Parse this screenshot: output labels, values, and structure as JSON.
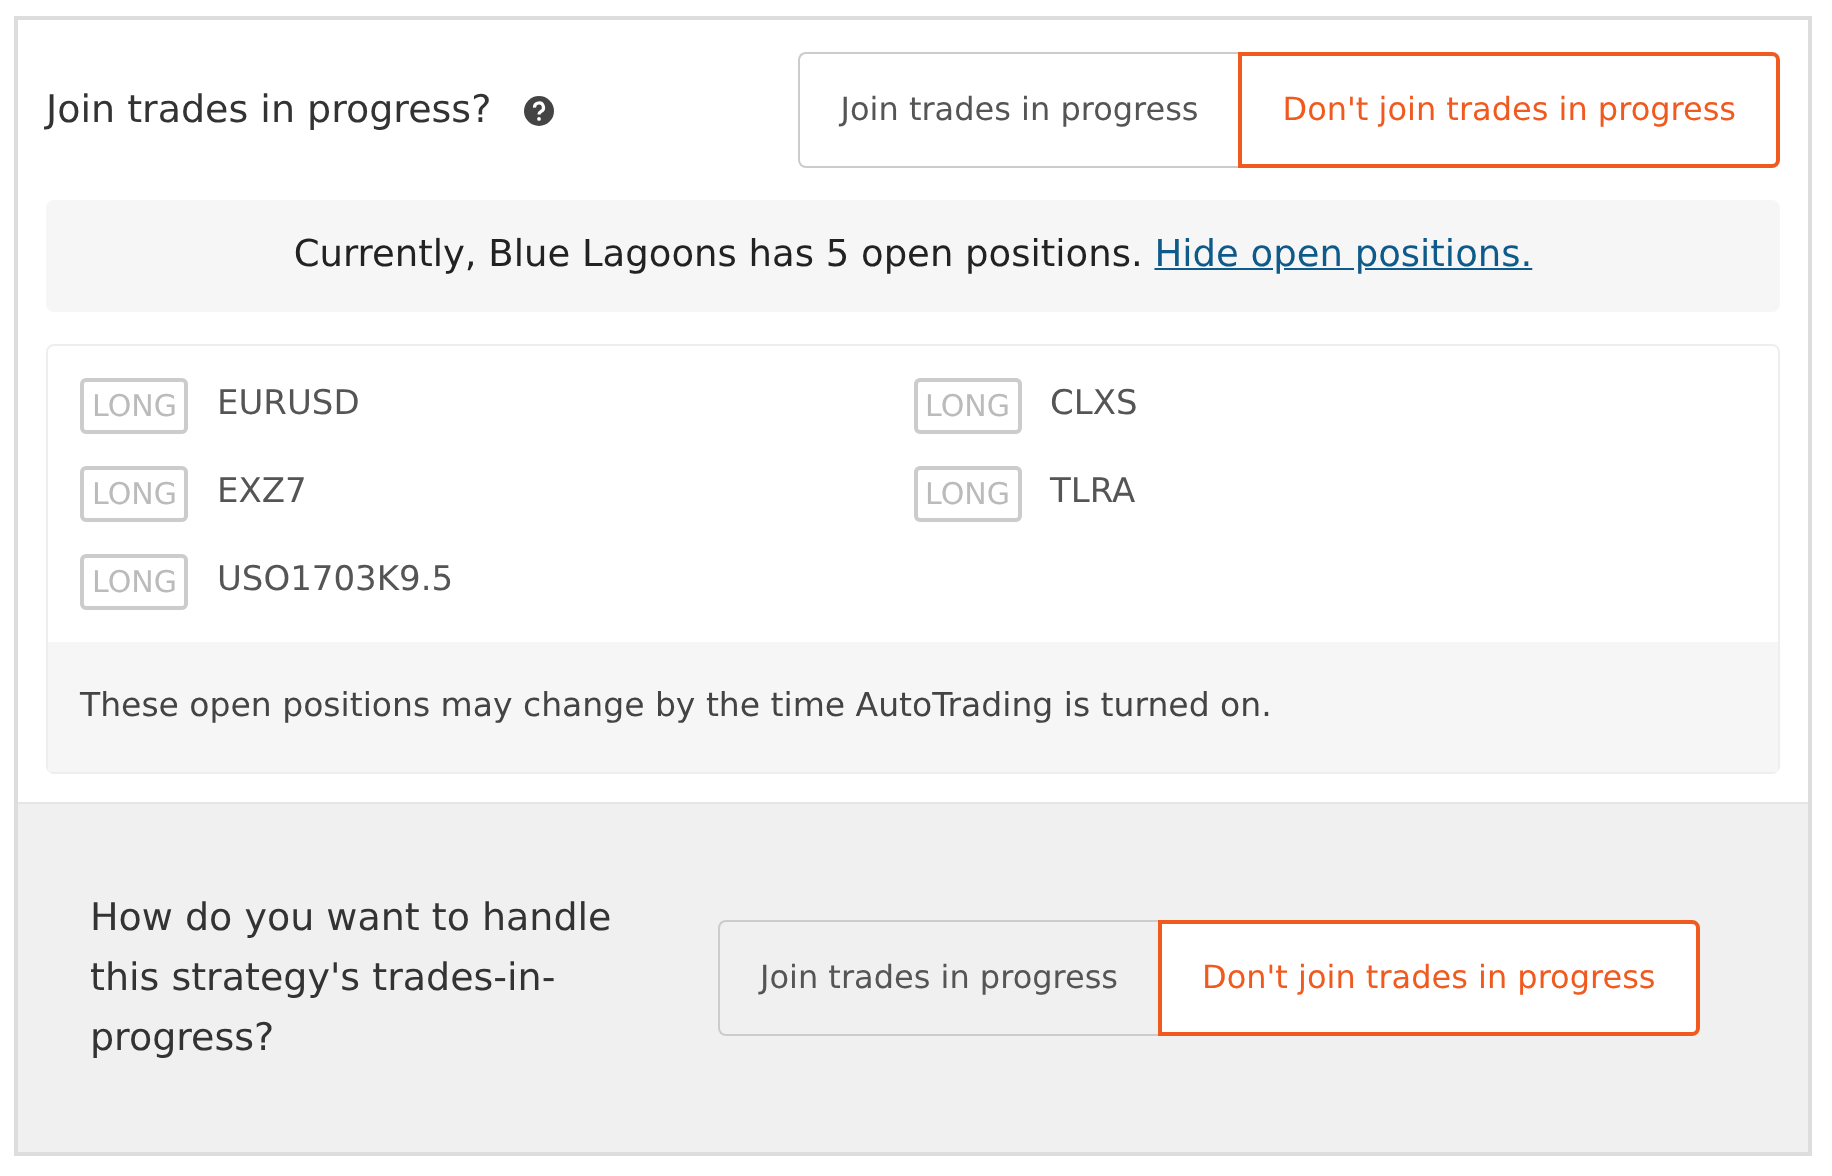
{
  "join_section": {
    "question": "Join trades in progress?",
    "options": [
      {
        "label": "Join trades in progress",
        "selected": false
      },
      {
        "label": "Don't join trades in progress",
        "selected": true
      }
    ]
  },
  "notice": {
    "text": "Currently, Blue Lagoons has 5 open positions.",
    "link": "Hide open positions."
  },
  "positions": [
    {
      "side": "LONG",
      "symbol": "EURUSD"
    },
    {
      "side": "LONG",
      "symbol": "CLXS"
    },
    {
      "side": "LONG",
      "symbol": "EXZ7"
    },
    {
      "side": "LONG",
      "symbol": "TLRA"
    },
    {
      "side": "LONG",
      "symbol": "USO1703K9.5"
    }
  ],
  "positions_note": "These open positions may change by the time AutoTrading is turned on.",
  "handle_section": {
    "question": "How do you want to handle this strategy's trades-in-progress?",
    "options": [
      {
        "label": "Join trades in progress",
        "selected": false
      },
      {
        "label": "Don't join trades in progress",
        "selected": true
      }
    ]
  }
}
